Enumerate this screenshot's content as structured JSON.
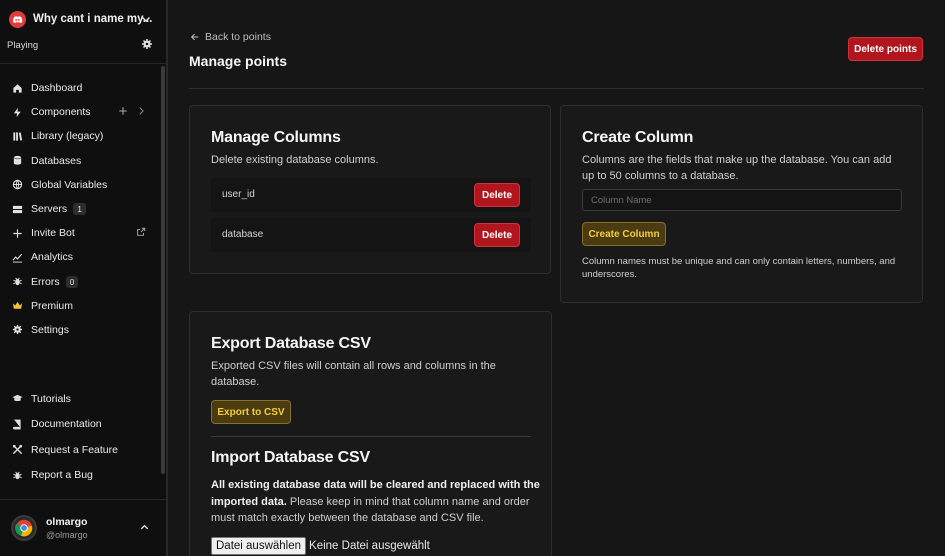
{
  "server": {
    "name": "Why cant i name my...",
    "status": "Playing"
  },
  "nav": {
    "items": [
      {
        "label": "Dashboard",
        "icon": "home-icon"
      },
      {
        "label": "Components",
        "icon": "bolt-icon"
      },
      {
        "label": "Library (legacy)",
        "icon": "library-icon"
      },
      {
        "label": "Databases",
        "icon": "database-icon"
      },
      {
        "label": "Global Variables",
        "icon": "globe-icon"
      },
      {
        "label": "Servers",
        "icon": "server-icon",
        "badge": "1"
      },
      {
        "label": "Invite Bot",
        "icon": "plus-icon"
      },
      {
        "label": "Analytics",
        "icon": "chart-icon"
      },
      {
        "label": "Errors",
        "icon": "bug-icon",
        "badge": "0"
      },
      {
        "label": "Premium",
        "icon": "crown-icon"
      },
      {
        "label": "Settings",
        "icon": "gear-icon"
      }
    ],
    "secondary": [
      {
        "label": "Tutorials",
        "icon": "graduation-cap-icon"
      },
      {
        "label": "Documentation",
        "icon": "book-icon"
      },
      {
        "label": "Request a Feature",
        "icon": "tools-icon"
      },
      {
        "label": "Report a Bug",
        "icon": "bug-icon"
      }
    ]
  },
  "user": {
    "name": "olmargo",
    "handle": "@olmargo"
  },
  "page": {
    "back_label": "Back to points",
    "title": "Manage points",
    "delete_label": "Delete points"
  },
  "manage_columns": {
    "title": "Manage Columns",
    "description": "Delete existing database columns.",
    "delete_label": "Delete",
    "columns": [
      "user_id",
      "database"
    ]
  },
  "create_column": {
    "title": "Create Column",
    "description": "Columns are the fields that make up the database. You can add up to 50 columns to a database.",
    "placeholder": "Column Name",
    "button_label": "Create Column",
    "hint": "Column names must be unique and can only contain letters, numbers, and underscores."
  },
  "export": {
    "title": "Export Database CSV",
    "description": "Exported CSV files will contain all rows and columns in the database.",
    "button_label": "Export to CSV"
  },
  "import": {
    "title": "Import Database CSV",
    "warning": "All existing database data will be cleared and replaced with the imported data.",
    "description": " Please keep in mind that column name and order must match exactly between the database and CSV file.",
    "file_button": "Datei auswählen",
    "file_status": "Keine Datei ausgewählt"
  },
  "colors": {
    "danger": "#b1151e",
    "gold": "#f4cd3e",
    "gold_bg": "#4a3c10",
    "discord": "#e23b3b"
  }
}
